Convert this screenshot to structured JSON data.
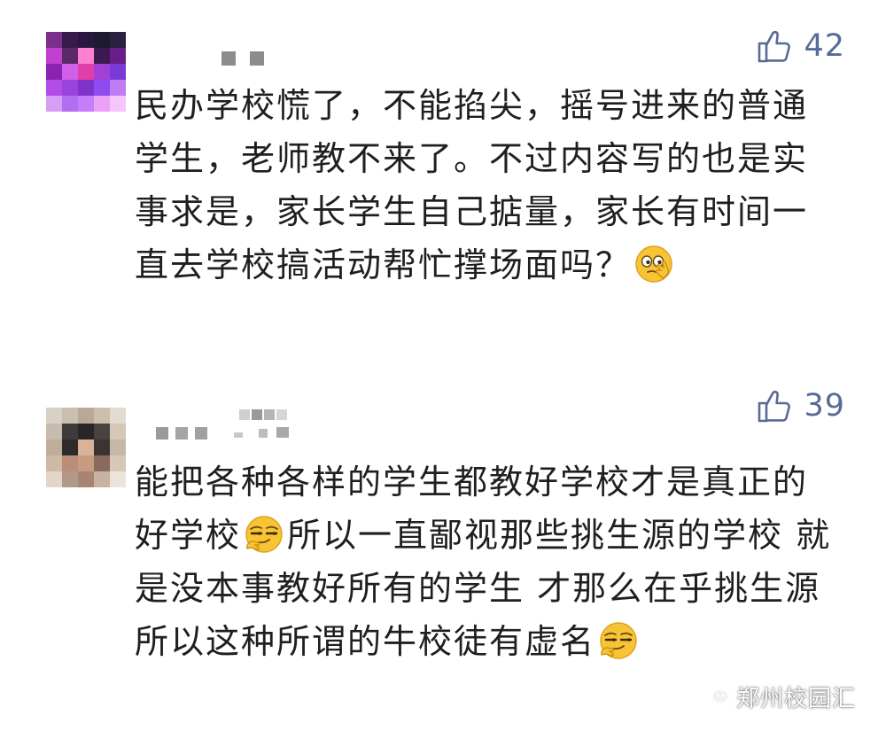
{
  "comments": [
    {
      "likes": "42",
      "text_before_emoji": "民办学校慌了，不能掐尖，摇号进来的普通学生，老师教不来了。不过内容写的也是实事求是，家长学生自己掂量，家长有时间一直去学校搞活动帮忙撑场面吗？",
      "emoji": "thinking-face-emoji"
    },
    {
      "likes": "39",
      "text_part_1": "能把各种各样的学生都教好学校才是真正的好学校",
      "emoji_1": "smirk-face-emoji",
      "text_part_2": "所以一直鄙视那些挑生源的学校 就是没本事教好所有的学生 才那么在乎挑生源 所以这种所谓的牛校徒有虚名",
      "emoji_2": "smirk-face-emoji"
    }
  ],
  "watermark": {
    "label": "郑州校园汇",
    "icon": "wechat-icon"
  },
  "colors": {
    "accent": "#576b95",
    "text": "#1f1f1f",
    "background": "#ffffff"
  }
}
